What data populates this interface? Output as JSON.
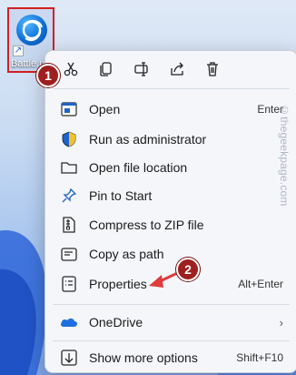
{
  "desktop_icon": {
    "label": "Battle.net"
  },
  "toolbar_icons": [
    "cut-icon",
    "copy-icon",
    "rename-icon",
    "share-icon",
    "delete-icon"
  ],
  "menu": {
    "items": [
      {
        "label": "Open",
        "shortcut": "Enter",
        "icon": "open-icon"
      },
      {
        "label": "Run as administrator",
        "shortcut": "",
        "icon": "shield-icon"
      },
      {
        "label": "Open file location",
        "shortcut": "",
        "icon": "folder-icon"
      },
      {
        "label": "Pin to Start",
        "shortcut": "",
        "icon": "pin-icon"
      },
      {
        "label": "Compress to ZIP file",
        "shortcut": "",
        "icon": "zip-icon"
      },
      {
        "label": "Copy as path",
        "shortcut": "",
        "icon": "copy-path-icon"
      },
      {
        "label": "Properties",
        "shortcut": "Alt+Enter",
        "icon": "properties-icon"
      },
      {
        "label": "OneDrive",
        "shortcut": "",
        "icon": "onedrive-icon"
      },
      {
        "label": "Show more options",
        "shortcut": "Shift+F10",
        "icon": "more-options-icon"
      }
    ]
  },
  "annotations": {
    "step1": "1",
    "step2": "2",
    "arrow_color": "#e03a3a"
  },
  "watermark": "©thegeekpage.com",
  "colors": {
    "accent": "#0f6fd6",
    "annotation": "#9e1f1f"
  }
}
